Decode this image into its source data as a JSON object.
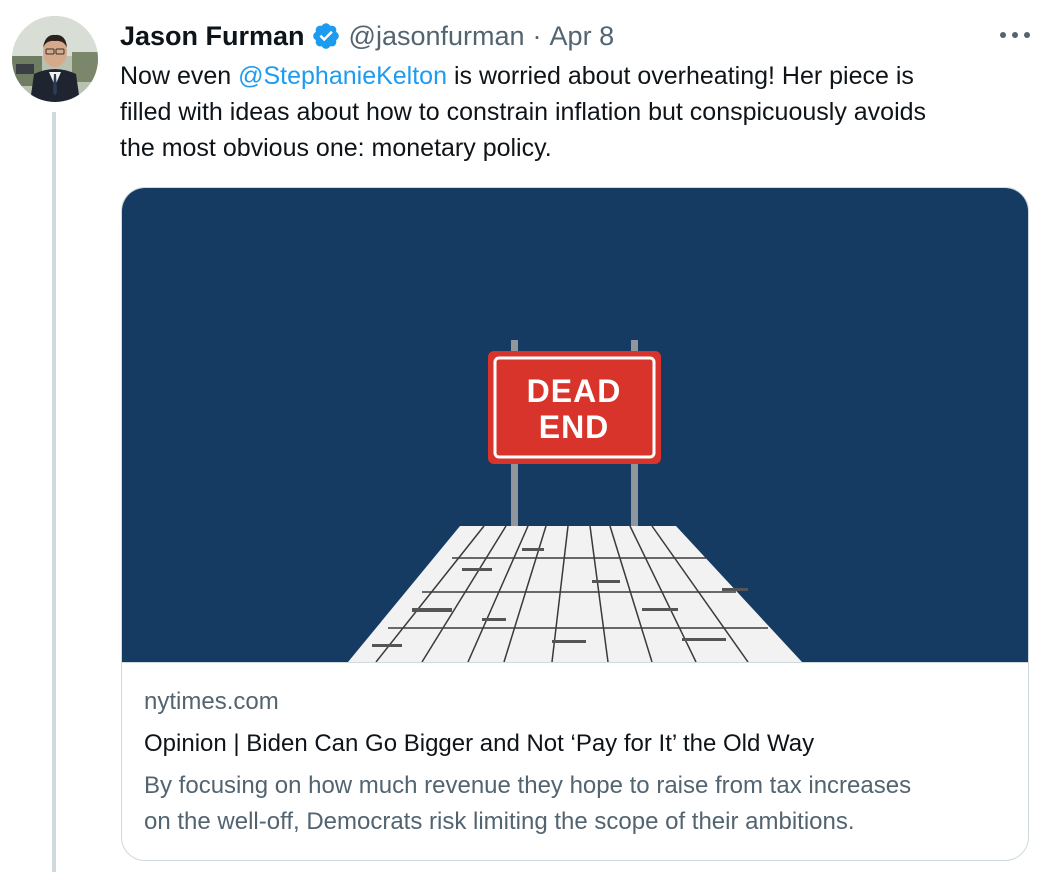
{
  "tweet": {
    "author": {
      "display_name": "Jason Furman",
      "handle": "@jasonfurman",
      "verified": true
    },
    "separator": "·",
    "date": "Apr 8",
    "more_label": "More",
    "text": {
      "line1_before": "Now even ",
      "mention": "@StephanieKelton",
      "line1_after": " is worried about overheating! Her piece is",
      "line2": "filled with ideas about how to constrain inflation but conspicuously avoids",
      "line3": "the most obvious one: monetary policy."
    },
    "card": {
      "image_sign_line1": "DEAD",
      "image_sign_line2": "END",
      "domain": "nytimes.com",
      "title": "Opinion | Biden Can Go Bigger and Not ‘Pay for It’ the Old Way",
      "description_line1": "By focusing on how much revenue they hope to raise from tax increases",
      "description_line2": "on the well-off, Democrats risk limiting the scope of their ambitions."
    }
  },
  "colors": {
    "accent": "#1d9bf0",
    "secondary_text": "#536471",
    "card_image_bg": "#163b62",
    "sign_red": "#d9342b"
  },
  "icons": {
    "verified": "verified-badge-icon",
    "more": "more-dots-icon"
  }
}
